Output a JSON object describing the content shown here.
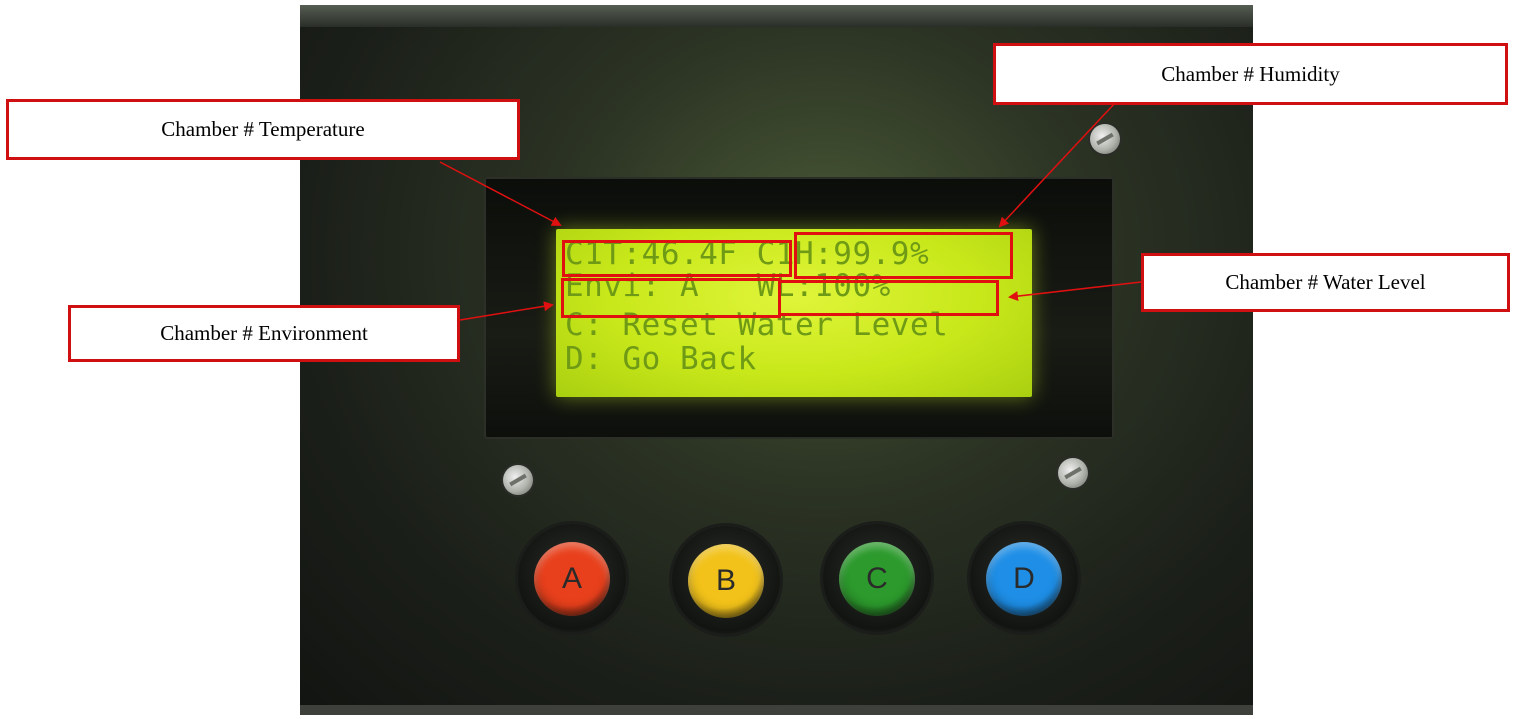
{
  "callouts": {
    "temperature": "Chamber # Temperature",
    "humidity": "Chamber # Humidity",
    "environment": "Chamber # Environment",
    "water_level": "Chamber # Water Level"
  },
  "lcd": {
    "line1": "C1T:46.4F C1H:99.9%",
    "line2": "Envi: A   WL:100%",
    "line3": "C: Reset Water Level",
    "line4": "D: Go Back"
  },
  "buttons": {
    "a": {
      "label": "A",
      "color": "#e8401c"
    },
    "b": {
      "label": "B",
      "color": "#f2c21a"
    },
    "c": {
      "label": "C",
      "color": "#2c9a2c"
    },
    "d": {
      "label": "D",
      "color": "#1e8ee6"
    }
  },
  "colors": {
    "annotation": "#e01010",
    "lcd_backlight": "#c8e81a",
    "lcd_text": "#6f9a16"
  }
}
